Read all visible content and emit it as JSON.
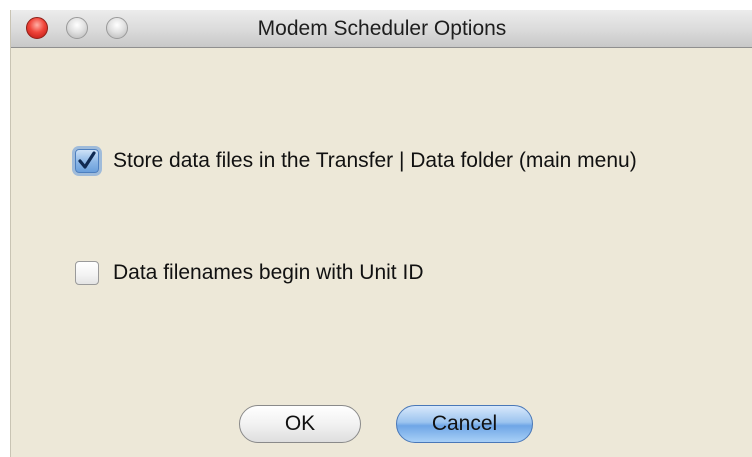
{
  "window": {
    "title": "Modem Scheduler Options"
  },
  "options": [
    {
      "label": "Store data files in the Transfer | Data folder (main menu)",
      "checked": true
    },
    {
      "label": "Data filenames begin with Unit ID",
      "checked": false
    }
  ],
  "buttons": {
    "ok_label": "OK",
    "cancel_label": "Cancel"
  },
  "colors": {
    "window_background": "#ede8d8",
    "close_button": "#f0453a",
    "focus_blue": "#6fa6e6"
  },
  "icons": {
    "check": "checkmark-icon"
  }
}
